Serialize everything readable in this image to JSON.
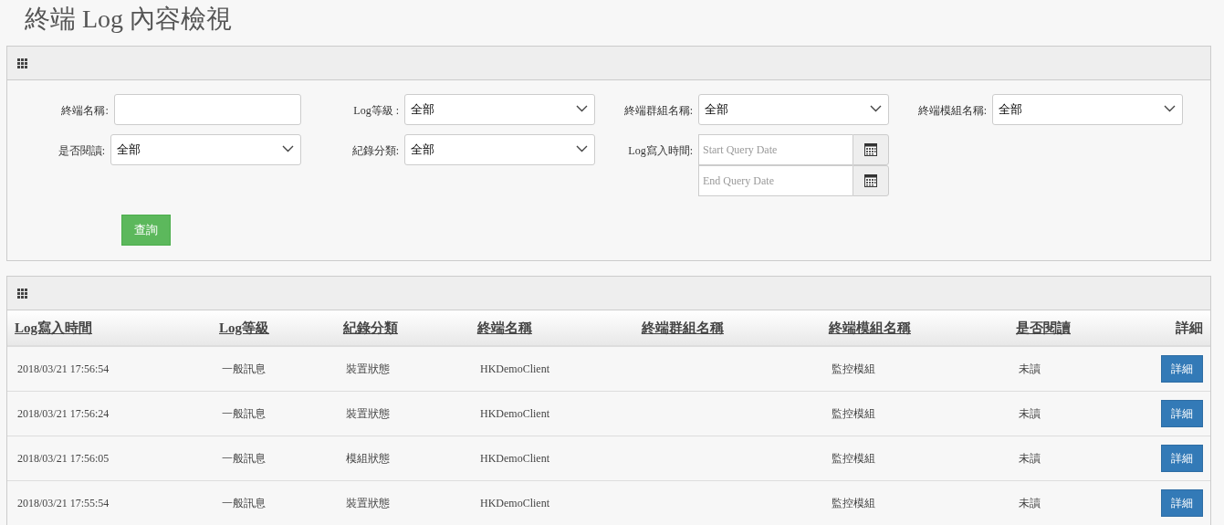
{
  "page_title": "終端 Log 內容檢視",
  "filter_rows": [
    [
      {
        "kind": "text",
        "label": "終端名稱:"
      },
      {
        "kind": "select",
        "label": "Log等級 :",
        "value": "全部"
      },
      {
        "kind": "select",
        "label": "終端群組名稱:",
        "value": "全部"
      },
      {
        "kind": "select",
        "label": "終端模組名稱:",
        "value": "全部"
      }
    ],
    [
      {
        "kind": "select",
        "label": "是否閱讀:",
        "value": "全部"
      },
      {
        "kind": "select",
        "label": "紀錄分類:",
        "value": "全部"
      },
      {
        "kind": "daterange",
        "label": "Log寫入時間:",
        "start_placeholder": "Start Query Date",
        "end_placeholder": "End Query Date"
      }
    ]
  ],
  "query_button": "查詢",
  "table": {
    "columns": [
      {
        "label": "Log寫入時間",
        "sortable": true
      },
      {
        "label": "Log等級",
        "sortable": true
      },
      {
        "label": "紀錄分類",
        "sortable": true
      },
      {
        "label": "終端名稱",
        "sortable": true
      },
      {
        "label": "終端群組名稱",
        "sortable": true
      },
      {
        "label": "終端模組名稱",
        "sortable": true
      },
      {
        "label": "是否閱讀",
        "sortable": true
      },
      {
        "label": "詳細",
        "sortable": false
      }
    ],
    "rows": [
      {
        "time": "2018/03/21 17:56:54",
        "level": "一般訊息",
        "category": "裝置狀態",
        "terminal": "HKDemoClient",
        "module": "監控模組",
        "read": "未讀",
        "detail": "詳細"
      },
      {
        "time": "2018/03/21 17:56:24",
        "level": "一般訊息",
        "category": "裝置狀態",
        "terminal": "HKDemoClient",
        "module": "監控模組",
        "read": "未讀",
        "detail": "詳細"
      },
      {
        "time": "2018/03/21 17:56:05",
        "level": "一般訊息",
        "category": "模組狀態",
        "terminal": "HKDemoClient",
        "module": "監控模組",
        "read": "未讀",
        "detail": "詳細"
      },
      {
        "time": "2018/03/21 17:55:54",
        "level": "一般訊息",
        "category": "裝置狀態",
        "terminal": "HKDemoClient",
        "module": "監控模組",
        "read": "未讀",
        "detail": "詳細"
      }
    ]
  }
}
